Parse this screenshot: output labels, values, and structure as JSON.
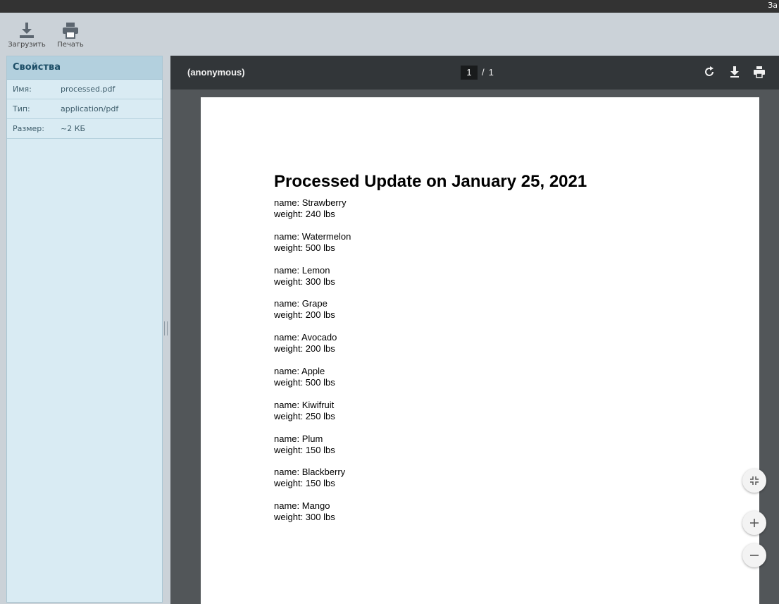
{
  "topbar": {
    "corner_text": "За"
  },
  "toolbar": {
    "download_label": "Загрузить",
    "print_label": "Печать"
  },
  "properties": {
    "title": "Свойства",
    "rows": [
      {
        "key": "Имя:",
        "value": "processed.pdf"
      },
      {
        "key": "Тип:",
        "value": "application/pdf"
      },
      {
        "key": "Размер:",
        "value": "~2 КБ"
      }
    ]
  },
  "viewer": {
    "title": "(anonymous)",
    "current_page": "1",
    "separator": "/",
    "total_pages": "1",
    "icons": [
      "rotate-icon",
      "download-icon",
      "print-icon",
      "fit-page-icon",
      "zoom-in-icon",
      "zoom-out-icon"
    ]
  },
  "document": {
    "heading": "Processed Update on January 25, 2021",
    "items": [
      {
        "name": "name: Strawberry",
        "weight": "weight: 240 lbs"
      },
      {
        "name": "name: Watermelon",
        "weight": "weight: 500 lbs"
      },
      {
        "name": "name: Lemon",
        "weight": "weight: 300 lbs"
      },
      {
        "name": "name: Grape",
        "weight": "weight: 200 lbs"
      },
      {
        "name": "name: Avocado",
        "weight": "weight: 200 lbs"
      },
      {
        "name": "name: Apple",
        "weight": "weight: 500 lbs"
      },
      {
        "name": "name: Kiwifruit",
        "weight": "weight: 250 lbs"
      },
      {
        "name": "name: Plum",
        "weight": "weight: 150 lbs"
      },
      {
        "name": "name: Blackberry",
        "weight": "weight: 150 lbs"
      },
      {
        "name": "name: Mango",
        "weight": "weight: 300 lbs"
      }
    ]
  }
}
